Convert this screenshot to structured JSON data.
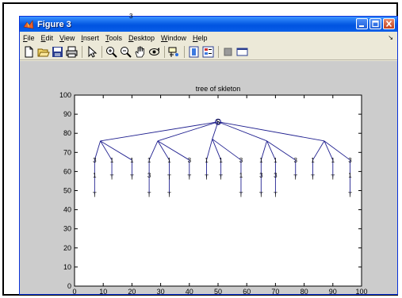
{
  "window": {
    "title": "Figure 3",
    "top_marker": "3"
  },
  "menu": {
    "items": [
      "File",
      "Edit",
      "View",
      "Insert",
      "Tools",
      "Desktop",
      "Window",
      "Help"
    ],
    "mnemonics": [
      "F",
      "E",
      "V",
      "I",
      "T",
      "D",
      "W",
      "H"
    ]
  },
  "toolbar": {
    "icons": [
      "new-file-icon",
      "open-folder-icon",
      "save-icon",
      "print-icon",
      "pointer-icon",
      "zoom-in-icon",
      "zoom-out-icon",
      "pan-icon",
      "rotate-3d-icon",
      "data-cursor-icon",
      "colorbar-icon",
      "legend-icon",
      "hide-plot-tools-icon",
      "show-plot-tools-icon"
    ]
  },
  "colors": {
    "titlebar": "#0a5fe6",
    "figure_background": "#cccccc",
    "axes_background": "#ffffff",
    "tree_line": "#1f1f8f"
  },
  "chart_data": {
    "type": "line",
    "title": "tree of skleton",
    "xlim": [
      0,
      100
    ],
    "ylim": [
      0,
      100
    ],
    "xticks": [
      0,
      10,
      20,
      30,
      40,
      50,
      60,
      70,
      80,
      90,
      100
    ],
    "yticks": [
      0,
      10,
      20,
      30,
      40,
      50,
      60,
      70,
      80,
      90,
      100
    ],
    "grid": false,
    "root": {
      "x": 50,
      "y": 86,
      "label": "S"
    },
    "level1": [
      {
        "x": 9,
        "y": 76
      },
      {
        "x": 29,
        "y": 76
      },
      {
        "x": 48,
        "y": 77
      },
      {
        "x": 67,
        "y": 76
      },
      {
        "x": 87,
        "y": 76
      }
    ],
    "level2": [
      {
        "parent": 0,
        "x": 7,
        "y": 66,
        "label": "3"
      },
      {
        "parent": 0,
        "x": 13,
        "y": 66,
        "label": "1"
      },
      {
        "parent": 0,
        "x": 20,
        "y": 66,
        "label": "1"
      },
      {
        "parent": 1,
        "x": 26,
        "y": 66,
        "label": "1"
      },
      {
        "parent": 1,
        "x": 33,
        "y": 66,
        "label": "1"
      },
      {
        "parent": 1,
        "x": 40,
        "y": 66,
        "label": "3"
      },
      {
        "parent": 2,
        "x": 46,
        "y": 66,
        "label": "1"
      },
      {
        "parent": 2,
        "x": 51,
        "y": 66,
        "label": "1"
      },
      {
        "parent": 2,
        "x": 58,
        "y": 66,
        "label": "3"
      },
      {
        "parent": 3,
        "x": 65,
        "y": 66,
        "label": "1"
      },
      {
        "parent": 3,
        "x": 70,
        "y": 66,
        "label": "1"
      },
      {
        "parent": 3,
        "x": 77,
        "y": 66,
        "label": "3"
      },
      {
        "parent": 4,
        "x": 83,
        "y": 66,
        "label": "1"
      },
      {
        "parent": 4,
        "x": 90,
        "y": 66,
        "label": "1"
      },
      {
        "parent": 4,
        "x": 96,
        "y": 66,
        "label": "3"
      }
    ],
    "level3": [
      {
        "parent": 0,
        "y": 58,
        "label": "1"
      },
      {
        "parent": 1,
        "y": 57,
        "label": "T"
      },
      {
        "parent": 2,
        "y": 57,
        "label": "T"
      },
      {
        "parent": 3,
        "y": 58,
        "label": "3"
      },
      {
        "parent": 4,
        "y": 57,
        "label": "T"
      },
      {
        "parent": 5,
        "y": 57,
        "label": "T"
      },
      {
        "parent": 6,
        "y": 57,
        "label": "T"
      },
      {
        "parent": 7,
        "y": 57,
        "label": "T"
      },
      {
        "parent": 8,
        "y": 58,
        "label": "1"
      },
      {
        "parent": 9,
        "y": 58,
        "label": "3"
      },
      {
        "parent": 10,
        "y": 58,
        "label": "3"
      },
      {
        "parent": 11,
        "y": 57,
        "label": "T"
      },
      {
        "parent": 12,
        "y": 57,
        "label": "T"
      },
      {
        "parent": 13,
        "y": 57,
        "label": "T"
      },
      {
        "parent": 14,
        "y": 58,
        "label": "1"
      }
    ],
    "level4": [
      {
        "parent": 0,
        "y": 48,
        "label": "T"
      },
      {
        "parent": 3,
        "y": 48,
        "label": "T"
      },
      {
        "parent": 4,
        "y": 48,
        "label": "T"
      },
      {
        "parent": 8,
        "y": 48,
        "label": "T"
      },
      {
        "parent": 9,
        "y": 48,
        "label": "T"
      },
      {
        "parent": 10,
        "y": 48,
        "label": "T"
      },
      {
        "parent": 14,
        "y": 48,
        "label": "T"
      }
    ]
  }
}
